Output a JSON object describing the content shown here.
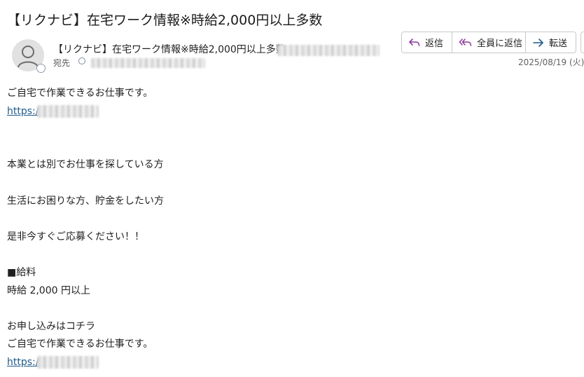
{
  "email": {
    "subject": "【リクナビ】在宅ワーク情報※時給2,000円以上多数",
    "from_display": "【リクナビ】在宅ワーク情報※時給2,000円以上多数",
    "to_label": "宛先",
    "date": "2025/08/19 (火)"
  },
  "actions": {
    "reply_label": "返信",
    "reply_all_label": "全員に返信",
    "forward_label": "転送"
  },
  "body": {
    "intro": "ご自宅で作業できるお仕事です。",
    "link_prefix": "https:/",
    "line_side_job": "本業とは別でお仕事を探している方",
    "line_money": "生活にお困りな方、貯金をしたい方",
    "line_apply_now": "是非今すぐご応募ください！！",
    "salary_heading": "■給料",
    "salary_value": "時給 2,000 円以上",
    "apply_here": "お申し込みはコチラ",
    "intro_repeat": "ご自宅で作業できるお仕事です。",
    "link_prefix_2": "https:/"
  },
  "colors": {
    "reply_icon": "#8b3a9e",
    "forward_icon": "#1e5a8a",
    "link": "#1e5a8a"
  },
  "icons": {
    "reply": "reply-arrow-icon",
    "reply_all": "reply-all-arrow-icon",
    "forward": "forward-arrow-icon",
    "avatar": "person-avatar-icon"
  }
}
